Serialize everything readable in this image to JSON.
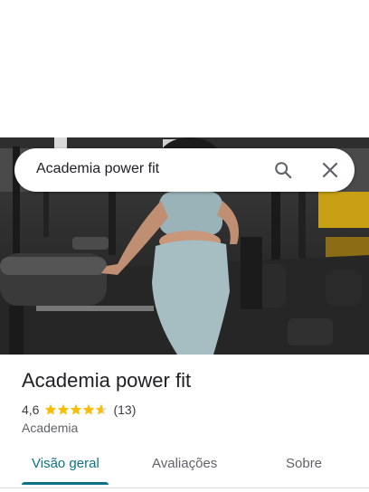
{
  "search": {
    "query": "Academia power fit"
  },
  "place": {
    "name": "Academia power fit",
    "rating": "4,6",
    "rating_stars": 4.6,
    "review_count": "(13)",
    "category": "Academia"
  },
  "tabs": [
    {
      "label": "Visão geral",
      "active": true
    },
    {
      "label": "Avaliações",
      "active": false
    },
    {
      "label": "Sobre",
      "active": false
    }
  ],
  "colors": {
    "accent": "#0b7285",
    "star": "#fbbc04",
    "star_empty": "#dadce0"
  },
  "icons": {
    "search": "search-icon",
    "close": "close-icon"
  }
}
